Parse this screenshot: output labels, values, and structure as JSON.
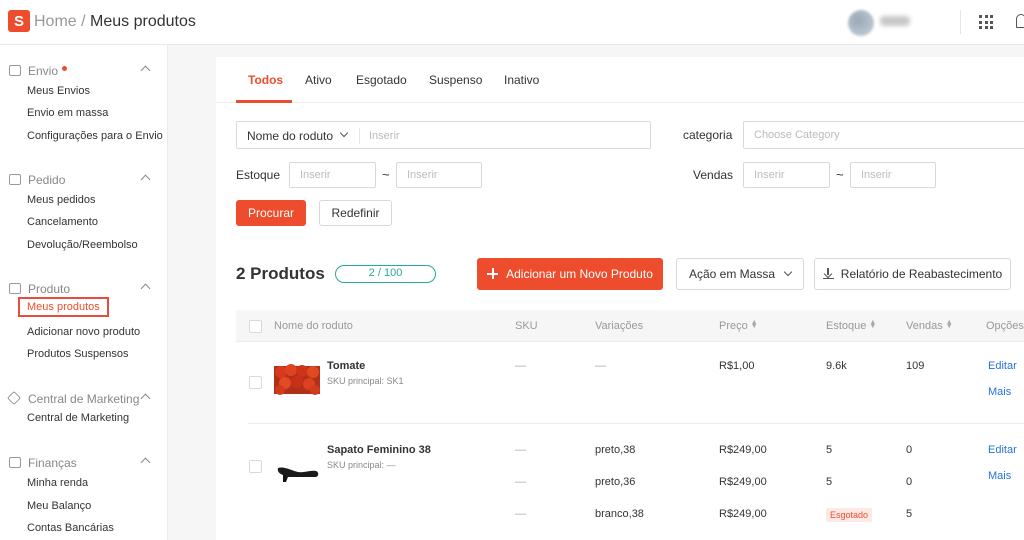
{
  "header": {
    "logo": "S",
    "home": "Home",
    "separator": "/",
    "current": "Meus produtos"
  },
  "sidebar": {
    "sections": [
      {
        "title": "Envio",
        "icon": "truck-icon",
        "has_dot": true,
        "items": [
          "Meus Envios",
          "Envio em massa",
          "Configurações para o Envio"
        ]
      },
      {
        "title": "Pedido",
        "icon": "clipboard-icon",
        "items": [
          "Meus pedidos",
          "Cancelamento",
          "Devolução/Reembolso"
        ]
      },
      {
        "title": "Produto",
        "icon": "box-icon",
        "items": [
          "Meus produtos",
          "Adicionar novo produto",
          "Produtos Suspensos"
        ],
        "active_item": "Meus produtos"
      },
      {
        "title": "Central de Marketing",
        "icon": "tag-icon",
        "items": [
          "Central de Marketing"
        ]
      },
      {
        "title": "Finanças",
        "icon": "wallet-icon",
        "items": [
          "Minha renda",
          "Meu Balanço",
          "Contas Bancárias"
        ]
      }
    ]
  },
  "tabs": [
    "Todos",
    "Ativo",
    "Esgotado",
    "Suspenso",
    "Inativo"
  ],
  "filters": {
    "name_select": "Nome do roduto",
    "name_placeholder": "Inserir",
    "category_label": "categoria",
    "category_placeholder": "Choose Category",
    "stock_label": "Estoque",
    "stock_min_placeholder": "Inserir",
    "stock_max_placeholder": "Inserir",
    "sales_label": "Vendas",
    "sales_min_placeholder": "Inserir",
    "sales_max_placeholder": "Inserir",
    "range_sep": "~",
    "search_button": "Procurar",
    "reset_button": "Redefinir"
  },
  "list": {
    "count_title": "2 Produtos",
    "quota": "2 / 100",
    "add_button": "Adicionar um Novo Produto",
    "bulk_button": "Ação em Massa",
    "report_button": "Relatório de Reabastecimento",
    "accent_color": "#ee4d2d",
    "quota_color": "#26aa99"
  },
  "table": {
    "columns": [
      "Nome do roduto",
      "SKU",
      "Variações",
      "Preço",
      "Estoque",
      "Vendas",
      "Opções"
    ],
    "dash": "—",
    "products": [
      {
        "name": "Tomate",
        "sku_main": "SKU principal: SK1",
        "rows": [
          {
            "sku": "—",
            "variation": "—",
            "price": "R$1,00",
            "stock": "9.6k",
            "sales": "109"
          }
        ],
        "actions": [
          "Editar",
          "Mais"
        ]
      },
      {
        "name": "Sapato Feminino 38",
        "sku_main": "SKU principal: —",
        "rows": [
          {
            "sku": "—",
            "variation": "preto,38",
            "price": "R$249,00",
            "stock": "5",
            "sales": "0"
          },
          {
            "sku": "—",
            "variation": "preto,36",
            "price": "R$249,00",
            "stock": "5",
            "sales": "0"
          },
          {
            "sku": "—",
            "variation": "branco,38",
            "price": "R$249,00",
            "stock_badge": "Esgotado",
            "sales": "5"
          }
        ],
        "actions": [
          "Editar",
          "Mais"
        ]
      }
    ]
  }
}
